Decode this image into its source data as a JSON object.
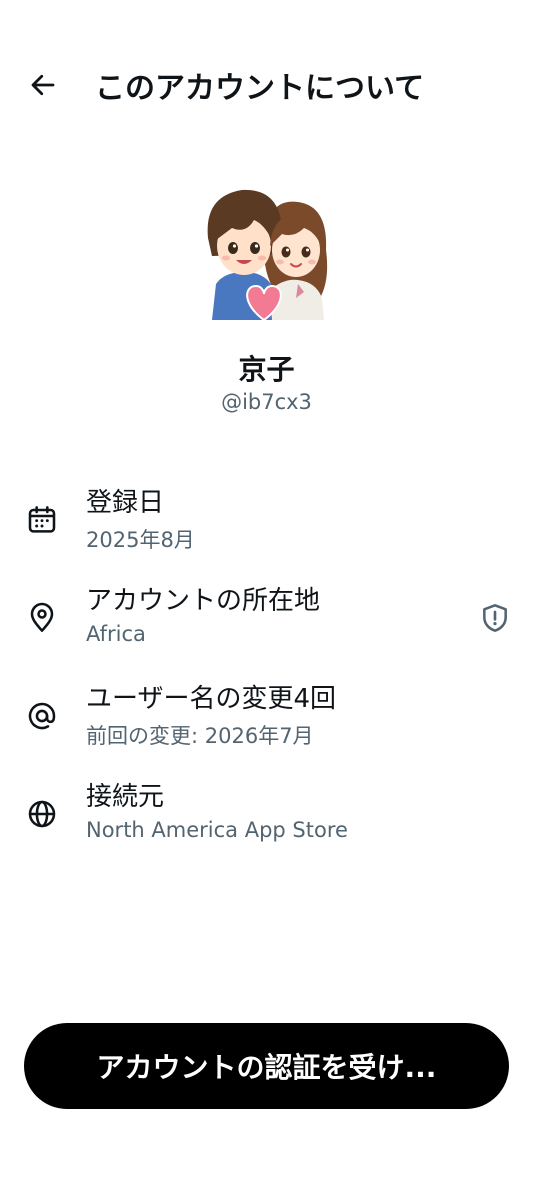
{
  "header": {
    "back_icon": "arrow-left-icon",
    "title": "このアカウントについて"
  },
  "profile": {
    "avatar": "couple-illustration-avatar",
    "display_name": "京子",
    "handle": "@ib7cx3"
  },
  "info": [
    {
      "icon": "calendar-icon",
      "title": "登録日",
      "subtitle": "2025年8月"
    },
    {
      "icon": "location-pin-icon",
      "title": "アカウントの所在地",
      "subtitle": "Africa",
      "trailing_icon": "shield-icon"
    },
    {
      "icon": "at-sign-icon",
      "title": "ユーザー名の変更4回",
      "subtitle": "前回の変更: 2026年7月"
    },
    {
      "icon": "globe-icon",
      "title": "接続元",
      "subtitle": "North America App Store"
    }
  ],
  "footer": {
    "verify_button_label": "アカウントの認証を受け..."
  },
  "colors": {
    "primary_text": "#0f1419",
    "secondary_text": "#536471",
    "button_bg": "#000000",
    "button_text": "#ffffff"
  }
}
